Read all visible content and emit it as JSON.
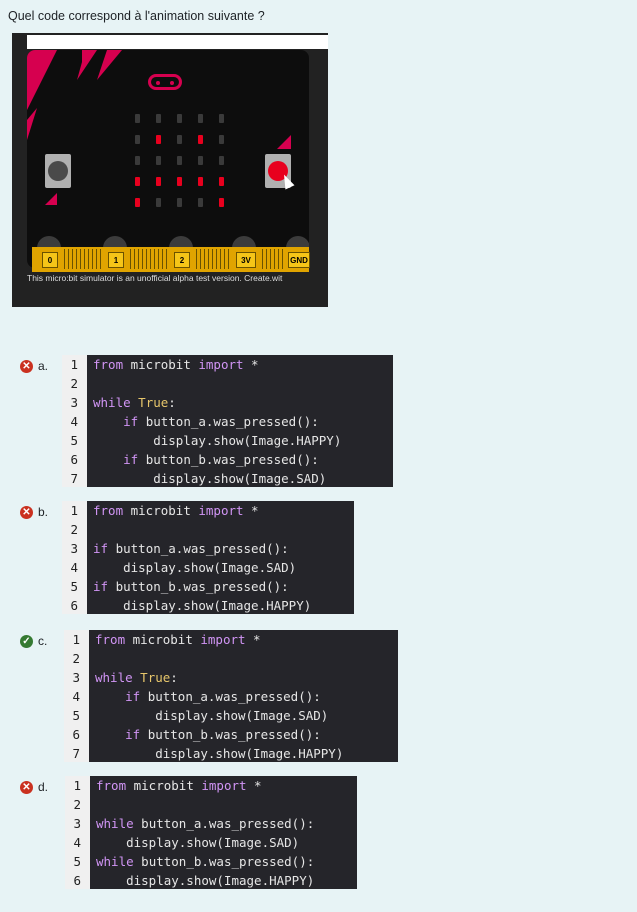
{
  "question": "Quel code correspond à l'animation suivante ?",
  "simulator": {
    "caption": "This micro:bit simulator is an unofficial alpha test version. Create.wit",
    "pin_labels": [
      "0",
      "1",
      "2",
      "3V",
      "GND"
    ],
    "led_on_color": "#e8001e",
    "led_off_color": "#3a3a3a",
    "pressed_button": "B"
  },
  "answers": [
    {
      "letter": "a.",
      "result": "incorrect",
      "icon": "cross-icon",
      "lines": [
        {
          "n": "1",
          "parts": [
            [
              "kw",
              "from"
            ],
            [
              "t",
              " microbit "
            ],
            [
              "kw",
              "import"
            ],
            [
              "t",
              " *"
            ]
          ]
        },
        {
          "n": "2",
          "parts": []
        },
        {
          "n": "3",
          "parts": [
            [
              "kw",
              "while"
            ],
            [
              "t",
              " "
            ],
            [
              "bool",
              "True"
            ],
            [
              "t",
              ":"
            ]
          ]
        },
        {
          "n": "4",
          "parts": [
            [
              "t",
              "    "
            ],
            [
              "kw",
              "if"
            ],
            [
              "t",
              " button_a.was_pressed():"
            ]
          ]
        },
        {
          "n": "5",
          "parts": [
            [
              "t",
              "        display.show(Image.HAPPY)"
            ]
          ]
        },
        {
          "n": "6",
          "parts": [
            [
              "t",
              "    "
            ],
            [
              "kw",
              "if"
            ],
            [
              "t",
              " button_b.was_pressed():"
            ]
          ]
        },
        {
          "n": "7",
          "parts": [
            [
              "t",
              "        display.show(Image.SAD)"
            ]
          ]
        }
      ]
    },
    {
      "letter": "b.",
      "result": "incorrect",
      "icon": "cross-icon",
      "lines": [
        {
          "n": "1",
          "parts": [
            [
              "kw",
              "from"
            ],
            [
              "t",
              " microbit "
            ],
            [
              "kw",
              "import"
            ],
            [
              "t",
              " *"
            ]
          ]
        },
        {
          "n": "2",
          "parts": []
        },
        {
          "n": "3",
          "parts": [
            [
              "kw",
              "if"
            ],
            [
              "t",
              " button_a.was_pressed():"
            ]
          ]
        },
        {
          "n": "4",
          "parts": [
            [
              "t",
              "    display.show(Image.SAD)"
            ]
          ]
        },
        {
          "n": "5",
          "parts": [
            [
              "kw",
              "if"
            ],
            [
              "t",
              " button_b.was_pressed():"
            ]
          ]
        },
        {
          "n": "6",
          "parts": [
            [
              "t",
              "    display.show(Image.HAPPY)"
            ]
          ]
        }
      ]
    },
    {
      "letter": "c.",
      "result": "correct",
      "icon": "check-icon",
      "lines": [
        {
          "n": "1",
          "parts": [
            [
              "kw",
              "from"
            ],
            [
              "t",
              " microbit "
            ],
            [
              "kw",
              "import"
            ],
            [
              "t",
              " *"
            ]
          ]
        },
        {
          "n": "2",
          "parts": []
        },
        {
          "n": "3",
          "parts": [
            [
              "kw",
              "while"
            ],
            [
              "t",
              " "
            ],
            [
              "bool",
              "True"
            ],
            [
              "t",
              ":"
            ]
          ]
        },
        {
          "n": "4",
          "parts": [
            [
              "t",
              "    "
            ],
            [
              "kw",
              "if"
            ],
            [
              "t",
              " button_a.was_pressed():"
            ]
          ]
        },
        {
          "n": "5",
          "parts": [
            [
              "t",
              "        display.show(Image.SAD)"
            ]
          ]
        },
        {
          "n": "6",
          "parts": [
            [
              "t",
              "    "
            ],
            [
              "kw",
              "if"
            ],
            [
              "t",
              " button_b.was_pressed():"
            ]
          ]
        },
        {
          "n": "7",
          "parts": [
            [
              "t",
              "        display.show(Image.HAPPY)"
            ]
          ]
        }
      ]
    },
    {
      "letter": "d.",
      "result": "incorrect",
      "icon": "cross-icon",
      "lines": [
        {
          "n": "1",
          "parts": [
            [
              "kw",
              "from"
            ],
            [
              "t",
              " microbit "
            ],
            [
              "kw",
              "import"
            ],
            [
              "t",
              " *"
            ]
          ]
        },
        {
          "n": "2",
          "parts": []
        },
        {
          "n": "3",
          "parts": [
            [
              "kw",
              "while"
            ],
            [
              "t",
              " button_a.was_pressed():"
            ]
          ]
        },
        {
          "n": "4",
          "parts": [
            [
              "t",
              "    display.show(Image.SAD)"
            ]
          ]
        },
        {
          "n": "5",
          "parts": [
            [
              "kw",
              "while"
            ],
            [
              "t",
              " button_b.was_pressed():"
            ]
          ]
        },
        {
          "n": "6",
          "parts": [
            [
              "t",
              "    display.show(Image.HAPPY)"
            ]
          ]
        }
      ]
    }
  ],
  "colors": {
    "correct": "#357a32",
    "incorrect": "#ca3120",
    "keyword": "#d195f5",
    "code_bg": "#25252a"
  }
}
